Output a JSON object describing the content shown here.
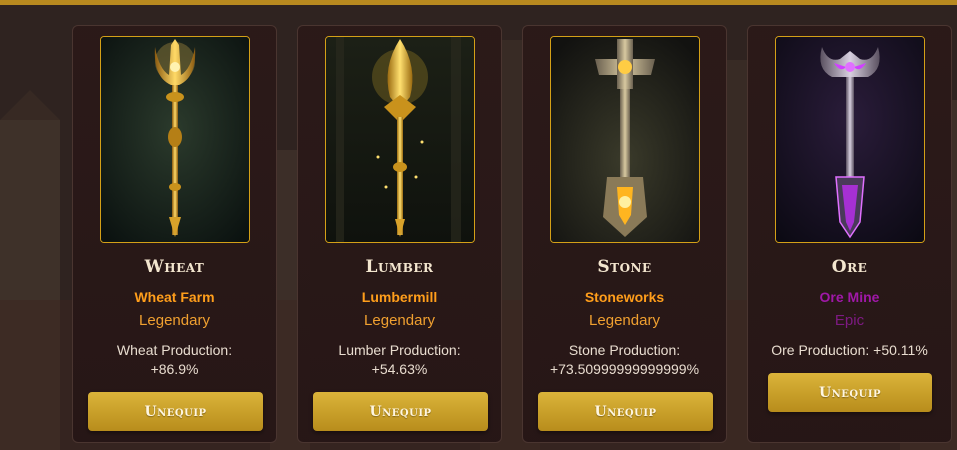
{
  "accent_color": "#b8891f",
  "cards": [
    {
      "resource": "Wheat",
      "building": "Wheat Farm",
      "rarity": "Legendary",
      "production_label": "Wheat Production:",
      "production_value": "+86.9%",
      "button_label": "Unequip",
      "art_icon": "golden-trident-scepter-icon"
    },
    {
      "resource": "Lumber",
      "building": "Lumbermill",
      "rarity": "Legendary",
      "production_label": "Lumber Production:",
      "production_value": "+54.63%",
      "button_label": "Unequip",
      "art_icon": "golden-leaf-scepter-icon"
    },
    {
      "resource": "Stone",
      "building": "Stoneworks",
      "rarity": "Legendary",
      "production_label": "Stone Production:",
      "production_value": "+73.50999999999999%",
      "button_label": "Unequip",
      "art_icon": "stone-hammer-scepter-icon"
    },
    {
      "resource": "Ore",
      "building": "Ore Mine",
      "rarity": "Epic",
      "production_label": "Ore Production: +50.11%",
      "button_label": "Unequip",
      "art_icon": "purple-axe-scepter-icon"
    }
  ]
}
